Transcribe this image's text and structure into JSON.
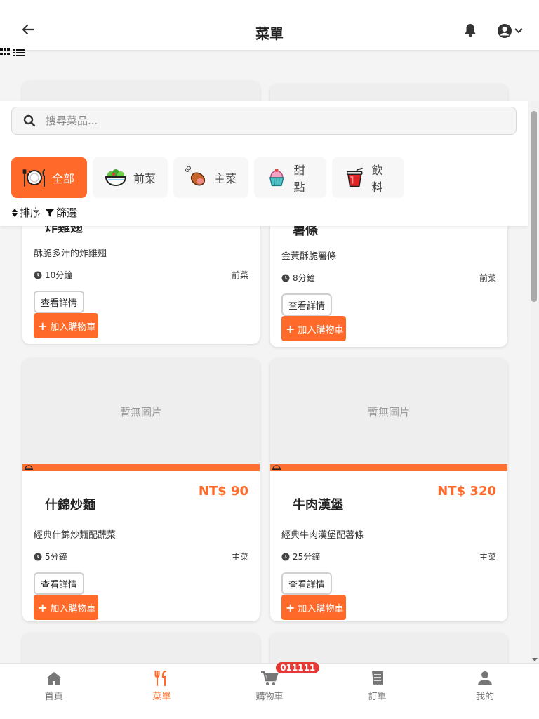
{
  "header": {
    "title": "菜單"
  },
  "search": {
    "placeholder": "搜尋菜品..."
  },
  "categories": [
    {
      "label": "全部",
      "icon": "plate-utensils-icon",
      "active": true
    },
    {
      "label": "前菜",
      "icon": "salad-bowl-icon"
    },
    {
      "label": "主菜",
      "icon": "meat-leg-icon"
    },
    {
      "label": "甜點",
      "icon": "cupcake-icon"
    },
    {
      "label": "飲料",
      "icon": "drink-cup-icon"
    }
  ],
  "toolbar": {
    "sort_label": "排序",
    "filter_label": "篩選"
  },
  "cards": [
    {
      "name": "炸雞翅",
      "desc": "酥脆多汁的炸雞翅",
      "time": "10分鐘",
      "category": "前菜"
    },
    {
      "name": "薯條",
      "desc": "金黃酥脆薯條",
      "time": "8分鐘",
      "category": "前菜"
    },
    {
      "name": "什錦炒麵",
      "price": "NT$ 90",
      "desc": "經典什錦炒麵配蔬菜",
      "time": "5分鐘",
      "category": "主菜",
      "no_image": "暫無圖片"
    },
    {
      "name": "牛肉漢堡",
      "price": "NT$ 320",
      "desc": "經典牛肉漢堡配薯條",
      "time": "25分鐘",
      "category": "主菜",
      "no_image": "暫無圖片"
    }
  ],
  "card_buttons": {
    "detail": "查看詳情",
    "add_to_cart": "加入購物車"
  },
  "nav": {
    "items": [
      {
        "label": "首頁",
        "icon": "home-icon"
      },
      {
        "label": "菜單",
        "icon": "utensils-icon",
        "active": true
      },
      {
        "label": "購物車",
        "icon": "cart-icon"
      },
      {
        "label": "訂單",
        "icon": "receipt-icon"
      },
      {
        "label": "我的",
        "icon": "user-icon"
      }
    ],
    "cart_badge": "011111"
  },
  "colors": {
    "accent": "#ff6a2b",
    "badge": "#e53935"
  }
}
